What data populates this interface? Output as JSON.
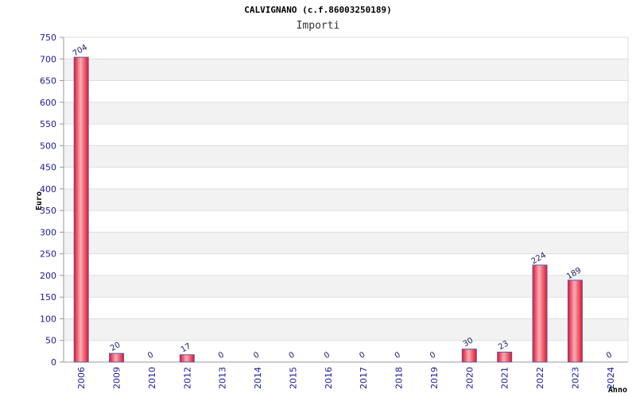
{
  "chart_data": {
    "type": "bar",
    "title": "CALVIGNANO (c.f.86003250189)",
    "subtitle": "Importi",
    "xlabel": "Anno",
    "ylabel": "Euro",
    "categories": [
      "2006",
      "2009",
      "2010",
      "2012",
      "2013",
      "2014",
      "2015",
      "2016",
      "2017",
      "2018",
      "2019",
      "2020",
      "2021",
      "2022",
      "2023",
      "2024"
    ],
    "values": [
      704,
      20,
      0,
      17,
      0,
      0,
      0,
      0,
      0,
      0,
      0,
      30,
      23,
      224,
      189,
      0
    ],
    "ylim": [
      0,
      750
    ],
    "yticks": [
      0,
      50,
      100,
      150,
      200,
      250,
      300,
      350,
      400,
      450,
      500,
      550,
      600,
      650,
      700,
      750
    ],
    "grid": true,
    "colors": {
      "bar": "#e8112d",
      "bar_highlight": "#f5b0b8",
      "bar_edge": "#5a5aa8",
      "band": "#f2f2f2",
      "tick_text": "#1a1a99"
    }
  }
}
